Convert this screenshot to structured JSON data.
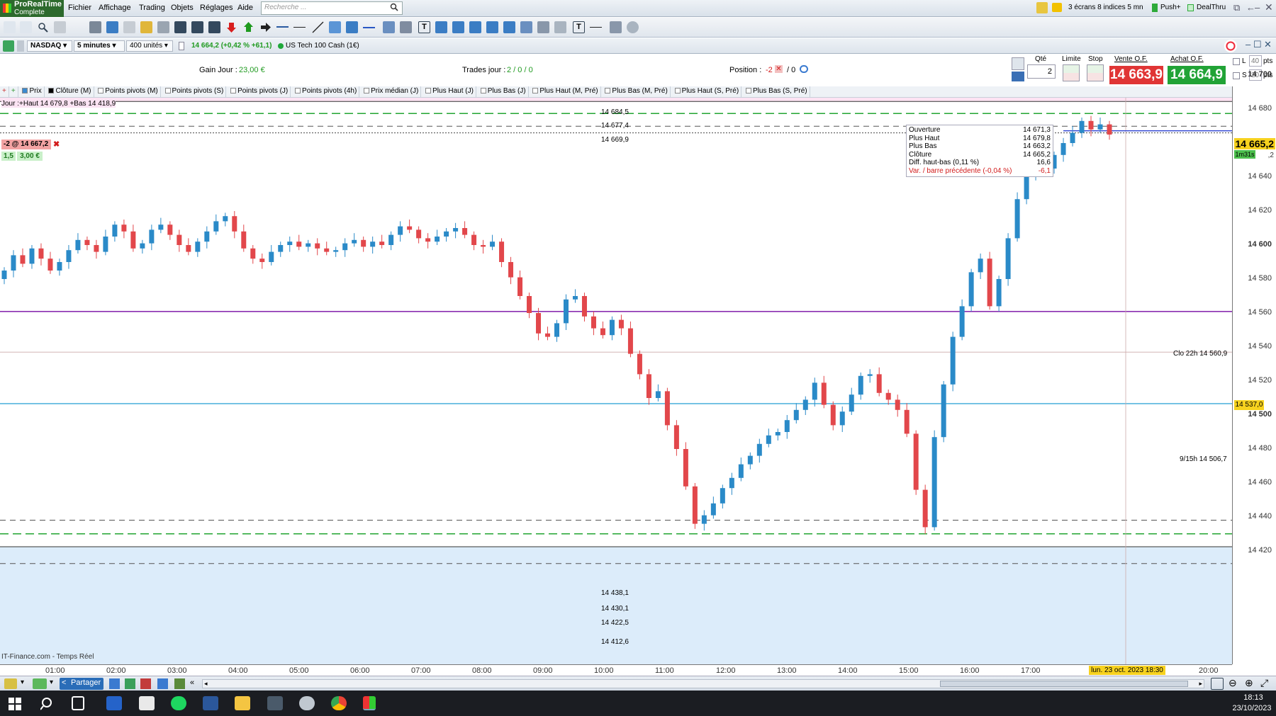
{
  "menu": {
    "logo_title": "ProRealTime",
    "logo_subtitle": "Complete",
    "items": [
      "Fichier",
      "Affichage",
      "Trading",
      "Objets",
      "Réglages",
      "Aide"
    ],
    "search_placeholder": "Recherche ...",
    "screens_info": "3 écrans 8 indices 5 mn",
    "push_label": "Push+",
    "dealthru_label": "DealThru"
  },
  "instrument": {
    "market": "NASDAQ",
    "timeframe": "5 minutes",
    "units": "400 unités",
    "quote": "14 664,2 (+0,42 % +61,1)",
    "name": "US Tech 100 Cash (1€)"
  },
  "info": {
    "gain_label": "Gain Jour :",
    "gain_value": "23,00 €",
    "trades_label": "Trades jour :",
    "trades_value": "2 / 0 / 0",
    "position_label": "Position :",
    "position_value": "-2",
    "position_extra": "/ 0"
  },
  "order_panel": {
    "qty_label": "Qté",
    "qty_value": "2",
    "limit_label": "Limite",
    "stop_label": "Stop",
    "sell_label": "Vente O.F.",
    "sell_price": "14 663,9",
    "buy_label": "Achat O.F.",
    "buy_price": "14 664,9",
    "l_label": "L",
    "l_value": "40",
    "s_label": "S",
    "s_value": "20",
    "pts": "pts"
  },
  "indicators": [
    "Prix",
    "Clôture (M)",
    "Points pivots (M)",
    "Points pivots (S)",
    "Points pivots (J)",
    "Points pivots (4h)",
    "Prix médian (J)",
    "Plus Haut (J)",
    "Plus Bas (J)",
    "Plus Haut (M, Pré)",
    "Plus Bas (M, Pré)",
    "Plus Haut (S, Pré)",
    "Plus Bas (S, Pré)"
  ],
  "chart": {
    "day_label": "Jour :+Haut 14 679,8 +Bas 14 418,9",
    "order_tag": "-2 @ 14 667,2",
    "order_qty": "1,5",
    "order_pnl": "3,00 €",
    "source": "IT-Finance.com - Temps Réel",
    "level_labels": [
      "14 684,5",
      "14 677,4",
      "14 669,9",
      "14 438,1",
      "14 430,1",
      "14 422,5",
      "14 412,6"
    ],
    "clo_label": "Clo 22h 14 560,9",
    "h915_label": "9/15h 14 506,7",
    "current_price": "14 665,2",
    "countdown": "1m31s",
    "crosshair_price": "14 537,0",
    "crosshair_date": "lun. 23 oct. 2023 18:30",
    "partial_price": ",2"
  },
  "tooltip": {
    "rows": [
      {
        "label": "Ouverture",
        "value": "14 671,3"
      },
      {
        "label": "Plus Haut",
        "value": "14 679,8"
      },
      {
        "label": "Plus Bas",
        "value": "14 663,2"
      },
      {
        "label": "Clôture",
        "value": "14 665,2"
      },
      {
        "label": "Diff. haut-bas (0,11 %)",
        "value": "16,6"
      },
      {
        "label": "Var. / barre précédente (-0,04 %)",
        "value": "-6,1"
      }
    ]
  },
  "y_axis": [
    "14 700",
    "14 680",
    "14 660",
    "14 640",
    "14 620",
    "14 600",
    "14 580",
    "14 560",
    "14 540",
    "14 520",
    "14 500",
    "14 480",
    "14 460",
    "14 440",
    "14 420"
  ],
  "x_axis": [
    "01:00",
    "02:00",
    "03:00",
    "04:00",
    "05:00",
    "06:00",
    "07:00",
    "08:00",
    "09:00",
    "10:00",
    "11:00",
    "12:00",
    "13:00",
    "14:00",
    "15:00",
    "16:00",
    "17:00",
    "20:00"
  ],
  "bottom": {
    "share_label": "Partager"
  },
  "taskbar": {
    "time": "18:13",
    "date": "23/10/2023"
  },
  "colors": {
    "up": "#2a8ac8",
    "down": "#e2474b",
    "pivot": "#22a532",
    "clo": "#8b2fb0",
    "h915": "#38a9d8"
  },
  "chart_data": {
    "type": "candlestick",
    "ylim": [
      14410,
      14700
    ],
    "close_series": [
      14585,
      14594,
      14589,
      14598,
      14592,
      14585,
      14590,
      14597,
      14603,
      14600,
      14596,
      14605,
      14612,
      14608,
      14598,
      14601,
      14609,
      14612,
      14606,
      14600,
      14596,
      14602,
      14608,
      14614,
      14617,
      14608,
      14598,
      14592,
      14590,
      14596,
      14600,
      14602,
      14599,
      14601,
      14598,
      14596,
      14597,
      14601,
      14603,
      14599,
      14602,
      14600,
      14606,
      14611,
      14609,
      14604,
      14602,
      14605,
      14608,
      14610,
      14606,
      14600,
      14599,
      14602,
      14590,
      14581,
      14570,
      14560,
      14548,
      14546,
      14554,
      14568,
      14570,
      14558,
      14551,
      14547,
      14556,
      14551,
      14536,
      14524,
      14510,
      14514,
      14494,
      14480,
      14458,
      14436,
      14441,
      14448,
      14457,
      14463,
      14471,
      14476,
      14483,
      14488,
      14490,
      14497,
      14503,
      14509,
      14519,
      14506,
      14494,
      14502,
      14512,
      14523,
      14524,
      14513,
      14509,
      14503,
      14489,
      14456,
      14434,
      14487,
      14518,
      14546,
      14564,
      14584,
      14592,
      14564,
      14580,
      14604,
      14627,
      14642,
      14650,
      14645,
      14653,
      14660,
      14666,
      14673,
      14668,
      14671,
      14665
    ],
    "open_series": [
      14580,
      14585,
      14594,
      14589,
      14598,
      14592,
      14585,
      14590,
      14597,
      14603,
      14600,
      14596,
      14605,
      14612,
      14608,
      14598,
      14601,
      14609,
      14612,
      14606,
      14600,
      14596,
      14602,
      14608,
      14614,
      14617,
      14608,
      14598,
      14592,
      14590,
      14596,
      14600,
      14602,
      14599,
      14601,
      14598,
      14596,
      14597,
      14601,
      14603,
      14599,
      14602,
      14600,
      14606,
      14611,
      14609,
      14604,
      14602,
      14605,
      14608,
      14610,
      14606,
      14600,
      14599,
      14602,
      14590,
      14581,
      14570,
      14560,
      14548,
      14546,
      14554,
      14568,
      14570,
      14558,
      14551,
      14547,
      14556,
      14551,
      14536,
      14524,
      14510,
      14514,
      14494,
      14480,
      14458,
      14436,
      14441,
      14448,
      14457,
      14463,
      14471,
      14476,
      14483,
      14488,
      14490,
      14497,
      14503,
      14509,
      14519,
      14506,
      14494,
      14502,
      14512,
      14523,
      14524,
      14513,
      14509,
      14503,
      14489,
      14456,
      14434,
      14487,
      14518,
      14546,
      14564,
      14584,
      14592,
      14564,
      14580,
      14604,
      14627,
      14642,
      14650,
      14645,
      14653,
      14660,
      14666,
      14673,
      14668,
      14671
    ],
    "levels": {
      "clo_22h": 14560.9,
      "h_9_15": 14506.7,
      "pivots": [
        14684.5,
        14677.4,
        14669.9,
        14438.1,
        14430.1,
        14422.5,
        14412.6
      ]
    }
  }
}
